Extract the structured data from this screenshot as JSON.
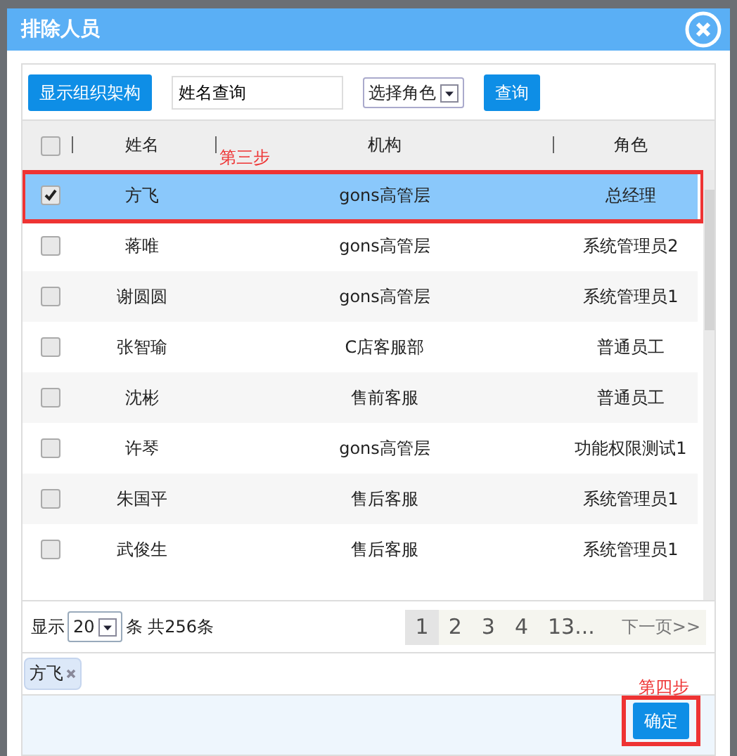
{
  "window": {
    "title": "排除人员"
  },
  "toolbar": {
    "org_button": "显示组织架构",
    "search": {
      "value": "姓名查询"
    },
    "role_select": "选择角色",
    "query_button": "查询"
  },
  "table": {
    "columns": [
      "姓名",
      "机构",
      "角色"
    ],
    "all_checked": false,
    "rows": [
      {
        "name": "方飞",
        "org": "gons高管层",
        "role": "总经理",
        "checked": true,
        "selected": true
      },
      {
        "name": "蒋唯",
        "org": "gons高管层",
        "role": "系统管理员2",
        "checked": false,
        "selected": false
      },
      {
        "name": "谢圆圆",
        "org": "gons高管层",
        "role": "系统管理员1",
        "checked": false,
        "selected": false
      },
      {
        "name": "张智瑜",
        "org": "C店客服部",
        "role": "普通员工",
        "checked": false,
        "selected": false
      },
      {
        "name": "沈彬",
        "org": "售前客服",
        "role": "普通员工",
        "checked": false,
        "selected": false
      },
      {
        "name": "许琴",
        "org": "gons高管层",
        "role": "功能权限测试1",
        "checked": false,
        "selected": false
      },
      {
        "name": "朱国平",
        "org": "售后客服",
        "role": "系统管理员1",
        "checked": false,
        "selected": false
      },
      {
        "name": "武俊生",
        "org": "售后客服",
        "role": "系统管理员1",
        "checked": false,
        "selected": false
      }
    ]
  },
  "pager": {
    "show_label": "显示",
    "page_size": "20",
    "total": "条 共256条",
    "pages": [
      {
        "label": "1",
        "selected": true
      },
      {
        "label": "2",
        "selected": false
      },
      {
        "label": "3",
        "selected": false
      },
      {
        "label": "4",
        "selected": false
      },
      {
        "label": "13...",
        "selected": false
      }
    ],
    "next": "下一页>>"
  },
  "selected_tags": [
    {
      "label": "方飞"
    }
  ],
  "footer": {
    "confirm_button": "确定"
  },
  "annotations": [
    {
      "kind": "row",
      "text": "第三步"
    },
    {
      "kind": "button",
      "text": "第四步"
    }
  ]
}
